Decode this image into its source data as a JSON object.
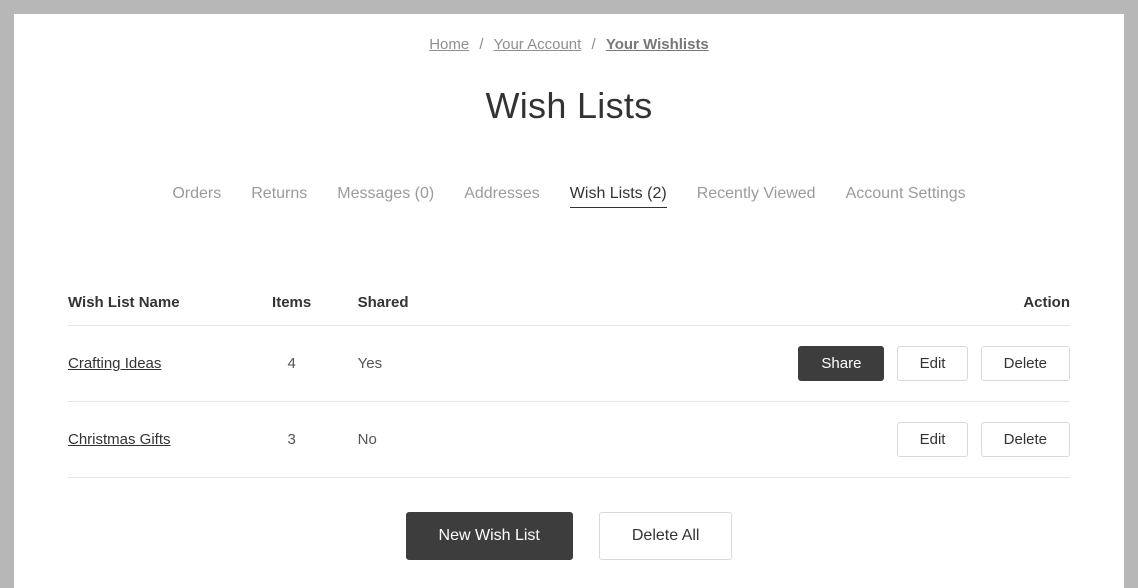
{
  "breadcrumb": {
    "home": "Home",
    "account": "Your Account",
    "current": "Your Wishlists"
  },
  "page_title": "Wish Lists",
  "tabs": {
    "orders": "Orders",
    "returns": "Returns",
    "messages": "Messages (0)",
    "addresses": "Addresses",
    "wishlists": "Wish Lists (2)",
    "recently_viewed": "Recently Viewed",
    "account_settings": "Account Settings"
  },
  "table": {
    "headers": {
      "name": "Wish List Name",
      "items": "Items",
      "shared": "Shared",
      "action": "Action"
    },
    "rows": [
      {
        "name": "Crafting Ideas",
        "items": "4",
        "shared": "Yes",
        "share_visible": true
      },
      {
        "name": "Christmas Gifts",
        "items": "3",
        "shared": "No",
        "share_visible": false
      }
    ],
    "buttons": {
      "share": "Share",
      "edit": "Edit",
      "delete": "Delete"
    }
  },
  "footer": {
    "new_list": "New Wish List",
    "delete_all": "Delete All"
  }
}
